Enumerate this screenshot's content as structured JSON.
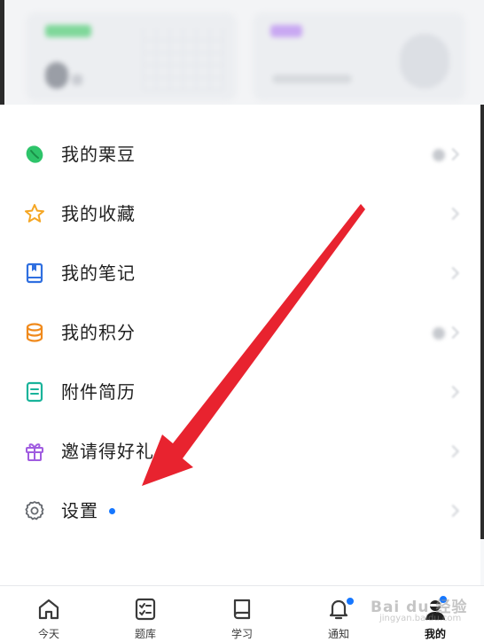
{
  "menu": {
    "items": [
      {
        "label": "我的栗豆",
        "icon": "bean-icon"
      },
      {
        "label": "我的收藏",
        "icon": "star-icon"
      },
      {
        "label": "我的笔记",
        "icon": "notebook-icon"
      },
      {
        "label": "我的积分",
        "icon": "coins-icon"
      },
      {
        "label": "附件简历",
        "icon": "resume-icon"
      },
      {
        "label": "邀请得好礼",
        "icon": "gift-icon"
      },
      {
        "label": "设置",
        "icon": "gear-icon"
      }
    ]
  },
  "bottom_nav": {
    "tabs": [
      {
        "label": "今天",
        "icon": "home-icon"
      },
      {
        "label": "题库",
        "icon": "question-bank-icon"
      },
      {
        "label": "学习",
        "icon": "book-icon"
      },
      {
        "label": "通知",
        "icon": "bell-icon"
      },
      {
        "label": "我的",
        "icon": "avatar-icon"
      }
    ],
    "active": "我的"
  },
  "watermark": {
    "brand": "Bai du 经验",
    "url": "jingyan.baidu.com"
  },
  "colors": {
    "accent": "#1677ff",
    "annotation_arrow": "#e8232f",
    "bean": "#2ec46a",
    "star": "#f5a623",
    "notebook": "#2f6fe0",
    "coins": "#f08a1c",
    "resume": "#19b39a",
    "gift": "#a05ce0",
    "gear": "#666a70"
  }
}
